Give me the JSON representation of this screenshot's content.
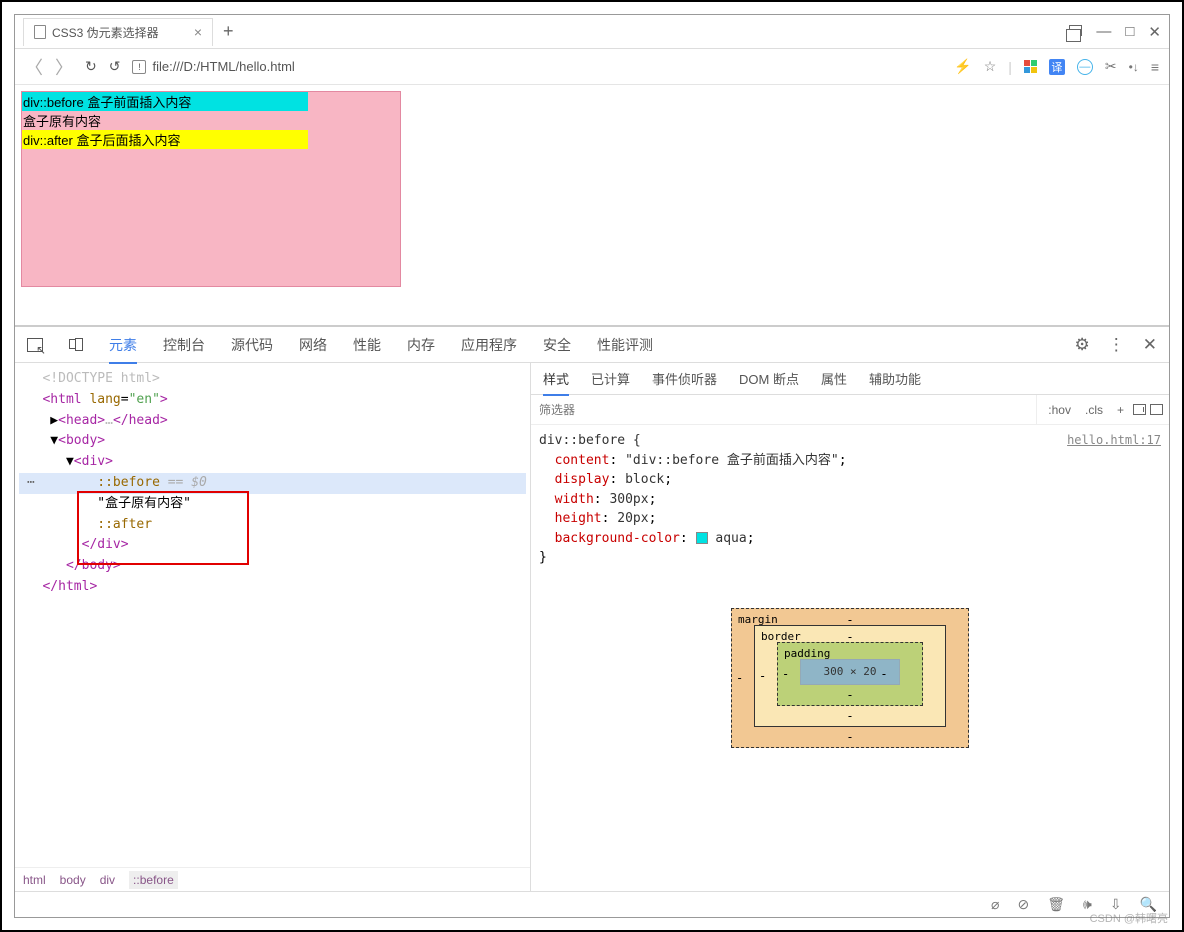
{
  "titlebar": {
    "tab_title": "CSS3 伪元素选择器"
  },
  "navbar": {
    "url": "file:///D:/HTML/hello.html"
  },
  "page": {
    "before_text": "div::before 盒子前面插入内容",
    "original_text": "盒子原有内容",
    "after_text": "div::after 盒子后面插入内容"
  },
  "devtools": {
    "tabs": [
      "元素",
      "控制台",
      "源代码",
      "网络",
      "性能",
      "内存",
      "应用程序",
      "安全",
      "性能评测"
    ],
    "style_tabs": [
      "样式",
      "已计算",
      "事件侦听器",
      "DOM 断点",
      "属性",
      "辅助功能"
    ],
    "filter_placeholder": "筛选器",
    "hov": ":hov",
    "cls": ".cls",
    "css": {
      "selector": "div::before {",
      "link": "hello.html:17",
      "p1": "content",
      "v1": "\"div::before 盒子前面插入内容\"",
      "p2": "display",
      "v2": "block",
      "p3": "width",
      "v3": "300px",
      "p4": "height",
      "v4": "20px",
      "p5": "background-color",
      "v5": "aqua",
      "close": "}"
    },
    "dom": {
      "doctype": "<!DOCTYPE html>",
      "html_open": "<html lang=\"en\">",
      "head": "<head>…</head>",
      "body_open": "<body>",
      "div_open": "<div>",
      "before": "::before",
      "eq0": " == $0",
      "text_node": "\"盒子原有内容\"",
      "after": "::after",
      "div_close": "</div>",
      "body_close": "</body>",
      "html_close": "</html>"
    },
    "crumbs": [
      "html",
      "body",
      "div",
      "::before"
    ],
    "box": {
      "margin": "margin",
      "border": "border",
      "padding": "padding",
      "content": "300 × 20",
      "dash": "-"
    }
  },
  "watermark": "CSDN @韩曙亮"
}
